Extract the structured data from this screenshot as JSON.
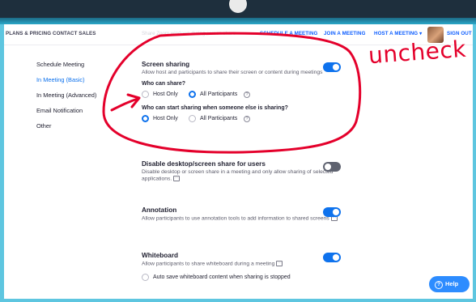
{
  "nav": {
    "plans_pricing": "PLANS & PRICING",
    "contact_sales": "CONTACT SALES",
    "ghost_text": "Share Zoom windows during screen share",
    "schedule": "SCHEDULE A MEETING",
    "join": "JOIN A MEETING",
    "host": "HOST A MEETING",
    "host_caret": "▾",
    "signout": "SIGN OUT"
  },
  "sidebar": {
    "items": [
      {
        "label": "Schedule Meeting"
      },
      {
        "label": "In Meeting (Basic)"
      },
      {
        "label": "In Meeting (Advanced)"
      },
      {
        "label": "Email Notification"
      },
      {
        "label": "Other"
      }
    ]
  },
  "screen_sharing": {
    "title": "Screen sharing",
    "description": "Allow host and participants to share their screen or content during meetings",
    "enabled": true,
    "who_can_share": {
      "label": "Who can share?",
      "options": [
        "Host Only",
        "All Participants"
      ],
      "selected": "All Participants",
      "help": "?"
    },
    "who_can_start": {
      "label": "Who can start sharing when someone else is sharing?",
      "options": [
        "Host Only",
        "All Participants"
      ],
      "selected": "Host Only",
      "help": "?"
    }
  },
  "disable_desktop": {
    "title": "Disable desktop/screen share for users",
    "description": "Disable desktop or screen share in a meeting and only allow sharing of selected applications.",
    "enabled": false
  },
  "annotation": {
    "title": "Annotation",
    "description": "Allow participants to use annotation tools to add information to shared screens",
    "enabled": true
  },
  "whiteboard": {
    "title": "Whiteboard",
    "description": "Allow participants to share whiteboard during a meeting",
    "enabled": true,
    "autosave_label": "Auto save whiteboard content when sharing is stopped"
  },
  "help": {
    "label": "Help",
    "icon": "?"
  },
  "annotations": {
    "handwritten": "uncheck",
    "color": "#e4002b"
  },
  "colors": {
    "accent": "#0e72ed",
    "toggle_off": "#5f6370",
    "frame": "#5ec6e0"
  }
}
